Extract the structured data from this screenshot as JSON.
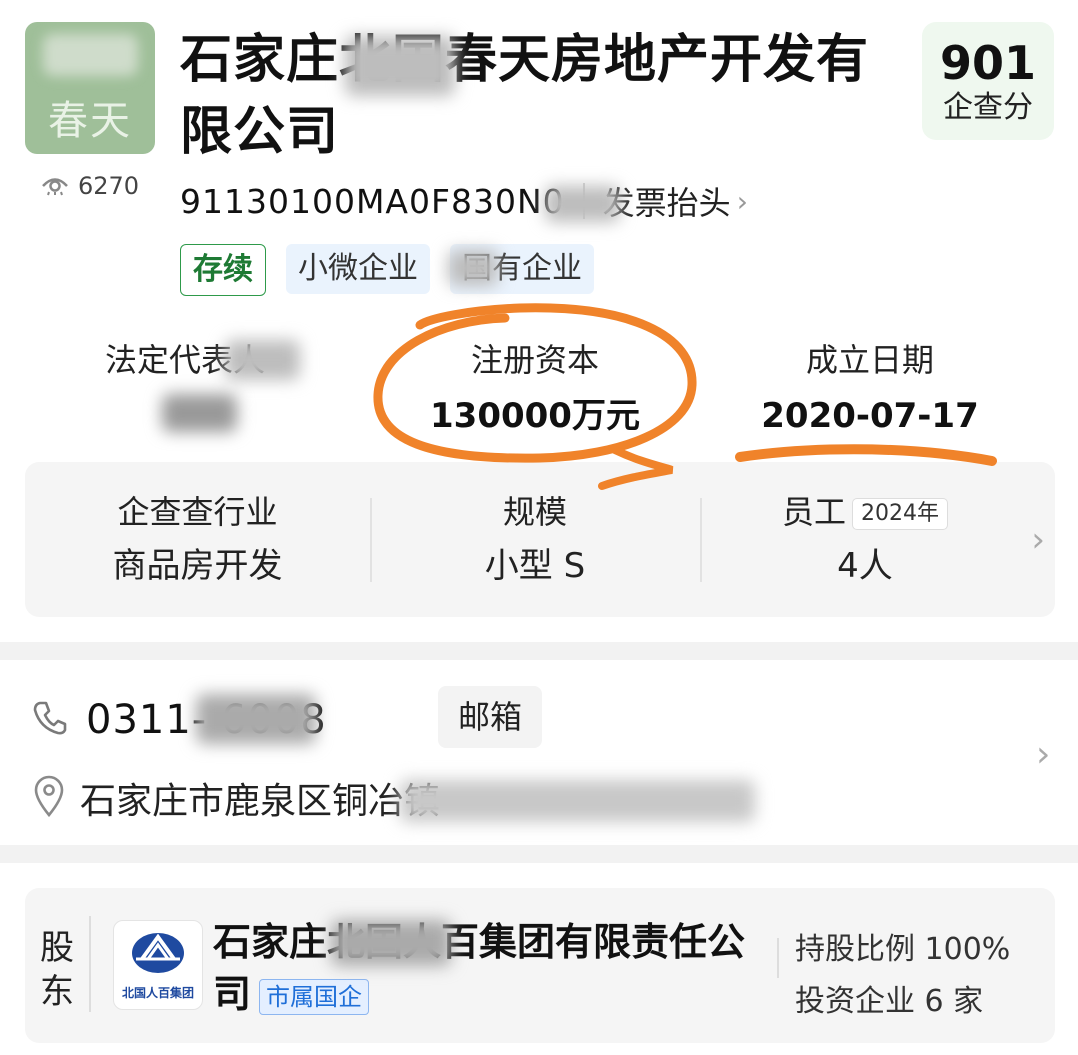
{
  "header": {
    "logo_text": "春天",
    "view_count": "6270",
    "company_name": "石家庄北国春天房地产开发有限公司",
    "score_value": "901",
    "score_label": "企查分",
    "credit_code": "91130100MA0F830N0",
    "invoice_label": "发票抬头",
    "tags": [
      "存续",
      "小微企业",
      "国有企业"
    ]
  },
  "key_fields": {
    "legal_rep_label": "法定代表人",
    "registered_capital_label": "注册资本",
    "registered_capital_value": "130000万元",
    "established_label": "成立日期",
    "established_value": "2020-07-17"
  },
  "info_panel": {
    "industry_label": "企查查行业",
    "industry_value": "商品房开发",
    "scale_label": "规模",
    "scale_value": "小型 S",
    "staff_label": "员工",
    "staff_year": "2024年",
    "staff_value": "4人"
  },
  "contact": {
    "phone": "0311-    6008",
    "email_button": "邮箱",
    "address": "石家庄市鹿泉区铜冶镇"
  },
  "shareholder": {
    "section_label": "股东",
    "logo_caption": "北国人百集团",
    "name": "石家庄北国人百集团有限责任公司",
    "badge": "市属国企",
    "stake": "持股比例 100%",
    "investments": "投资企业 6 家"
  },
  "colors": {
    "annotation": "#f0832a",
    "tag_green": "#2e9a4a",
    "badge_blue": "#1f6fd8",
    "logo_green": "#9fbf99"
  }
}
